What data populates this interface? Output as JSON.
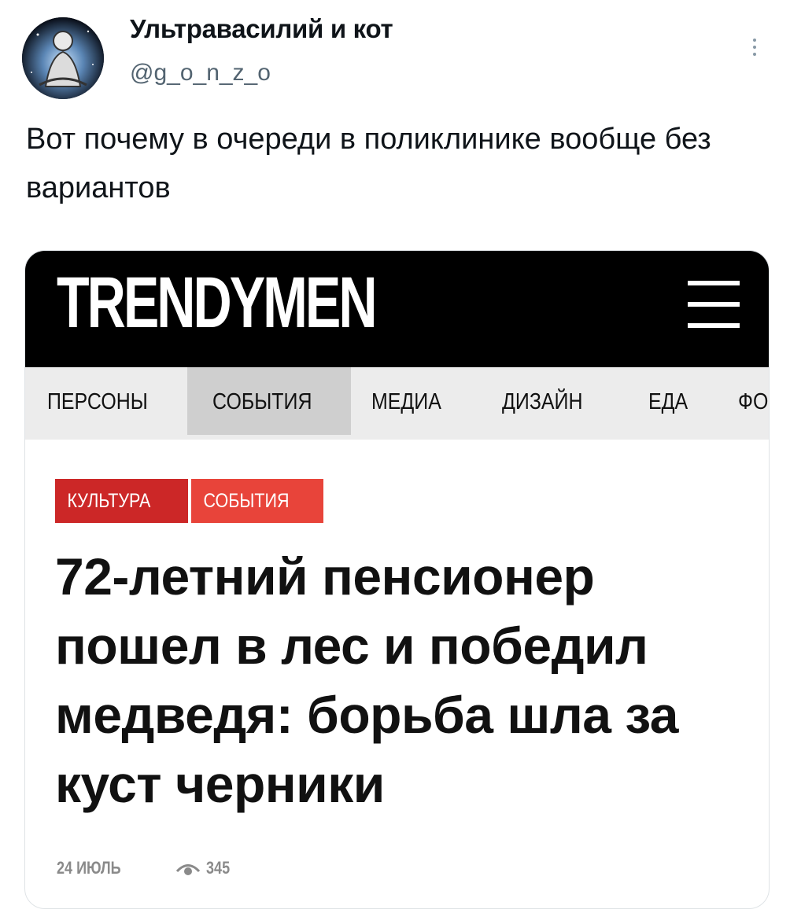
{
  "tweet": {
    "author_name": "Ультравасилий и кот",
    "author_handle": "@g_o_n_z_o",
    "text": "Вот почему в очереди в поликлинике вообще без вариантов"
  },
  "card": {
    "site_logo": "TRENDYMEN",
    "nav_items": [
      "ПЕРСОНЫ",
      "СОБЫТИЯ",
      "МЕДИА",
      "ДИЗАЙН",
      "ЕДА",
      "ФО"
    ],
    "active_nav": "СОБЫТИЯ",
    "tags": [
      "КУЛЬТУРА",
      "СОБЫТИЯ"
    ],
    "headline": "72-летний пенсионер пошел в лес и победил медведя: борьба шла за куст черники",
    "date": "24 ИЮЛЬ",
    "views": "345"
  },
  "colors": {
    "header_bg": "#000000",
    "nav_bg": "#ececec",
    "tag_culture": "#cc2727",
    "tag_events": "#e8443a",
    "handle_gray": "#536471"
  },
  "icons": [
    "avatar-image",
    "more-options-icon",
    "hamburger-menu-icon",
    "eye-icon"
  ]
}
